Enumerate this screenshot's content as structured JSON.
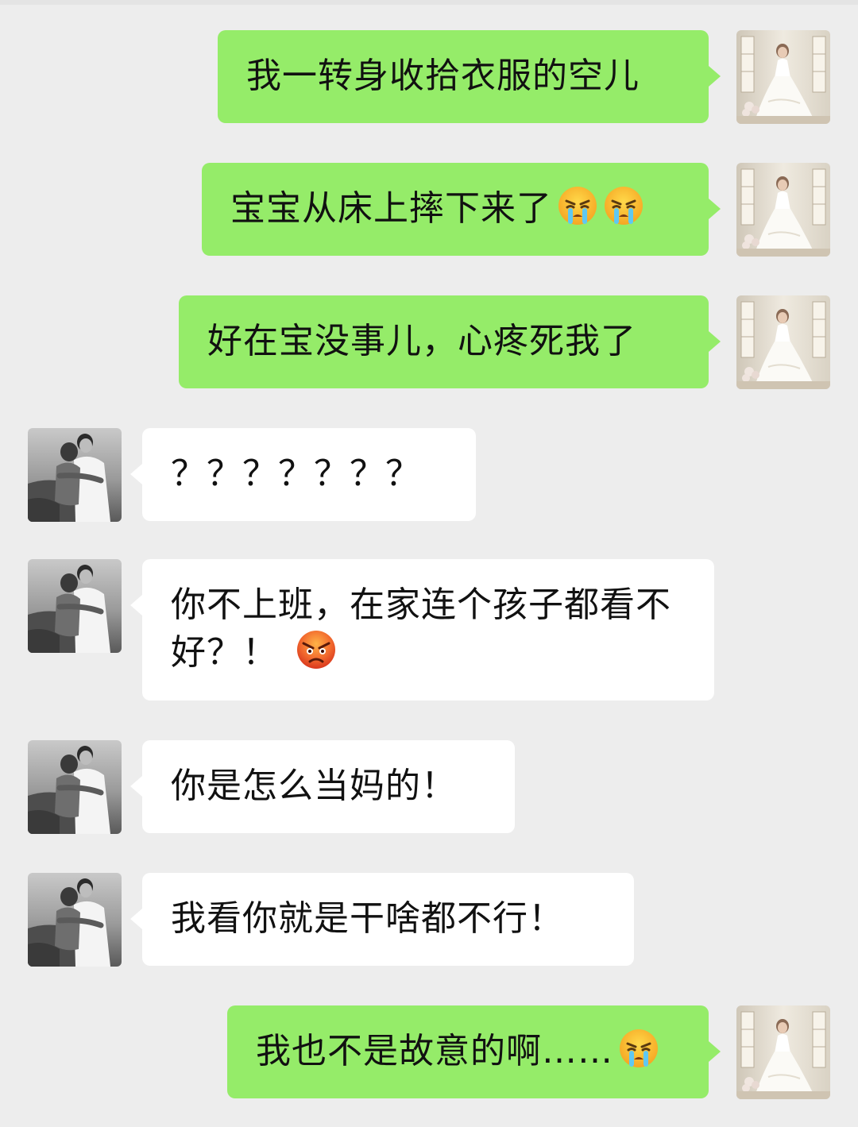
{
  "messages": [
    {
      "side": "out",
      "text": "我一转身收拾衣服的空儿",
      "emojis": []
    },
    {
      "side": "out",
      "text": "宝宝从床上摔下来了",
      "emojis": [
        "loudly-crying-face-emoji",
        "loudly-crying-face-emoji"
      ]
    },
    {
      "side": "out",
      "text": "好在宝没事儿，心疼死我了",
      "emojis": []
    },
    {
      "side": "in",
      "text": "？？？？？？？",
      "emojis": []
    },
    {
      "side": "in",
      "text": "你不上班，在家连个孩子都看不好？！",
      "emojis": [
        "angry-face-emoji"
      ]
    },
    {
      "side": "in",
      "text": "你是怎么当妈的！",
      "emojis": []
    },
    {
      "side": "in",
      "text": "我看你就是干啥都不行！",
      "emojis": []
    },
    {
      "side": "out",
      "text": "我也不是故意的啊……",
      "emojis": [
        "loudly-crying-face-emoji"
      ]
    }
  ],
  "colors": {
    "background": "#ededed",
    "outgoing_bubble": "#95ec69",
    "incoming_bubble": "#ffffff"
  }
}
